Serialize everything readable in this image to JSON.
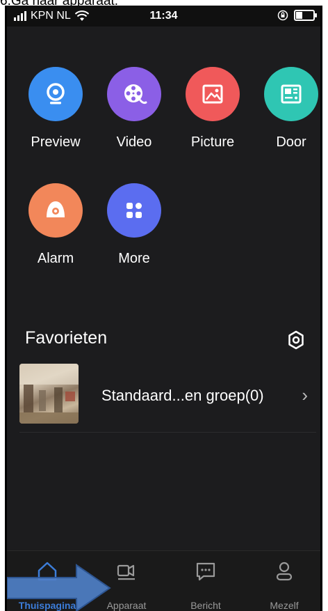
{
  "caption": "6.Ga naar apparaat.",
  "status_bar": {
    "carrier": "KPN NL",
    "time": "11:34"
  },
  "apps": [
    {
      "label": "Preview",
      "icon": "camera-icon",
      "color": "#3a8ef0"
    },
    {
      "label": "Video",
      "icon": "film-reel-icon",
      "color": "#8b5fe6"
    },
    {
      "label": "Picture",
      "icon": "image-icon",
      "color": "#f0595a"
    },
    {
      "label": "Door",
      "icon": "intercom-icon",
      "color": "#2fc6b3"
    },
    {
      "label": "Alarm",
      "icon": "alarm-icon",
      "color": "#f2875a"
    },
    {
      "label": "More",
      "icon": "grid-icon",
      "color": "#5b6df0"
    }
  ],
  "favorites": {
    "title": "Favorieten",
    "items": [
      {
        "name": "Standaard...en groep(0)"
      }
    ]
  },
  "bottom_nav": {
    "items": [
      {
        "label": "Thuispagina",
        "icon": "home-icon",
        "active": true
      },
      {
        "label": "Apparaat",
        "icon": "device-icon",
        "active": false
      },
      {
        "label": "Bericht",
        "icon": "message-icon",
        "active": false
      },
      {
        "label": "Mezelf",
        "icon": "user-icon",
        "active": false
      }
    ]
  },
  "colors": {
    "background": "#1c1c1e",
    "active_tab": "#3c7dd9",
    "arrow": "#4f7fc6"
  }
}
